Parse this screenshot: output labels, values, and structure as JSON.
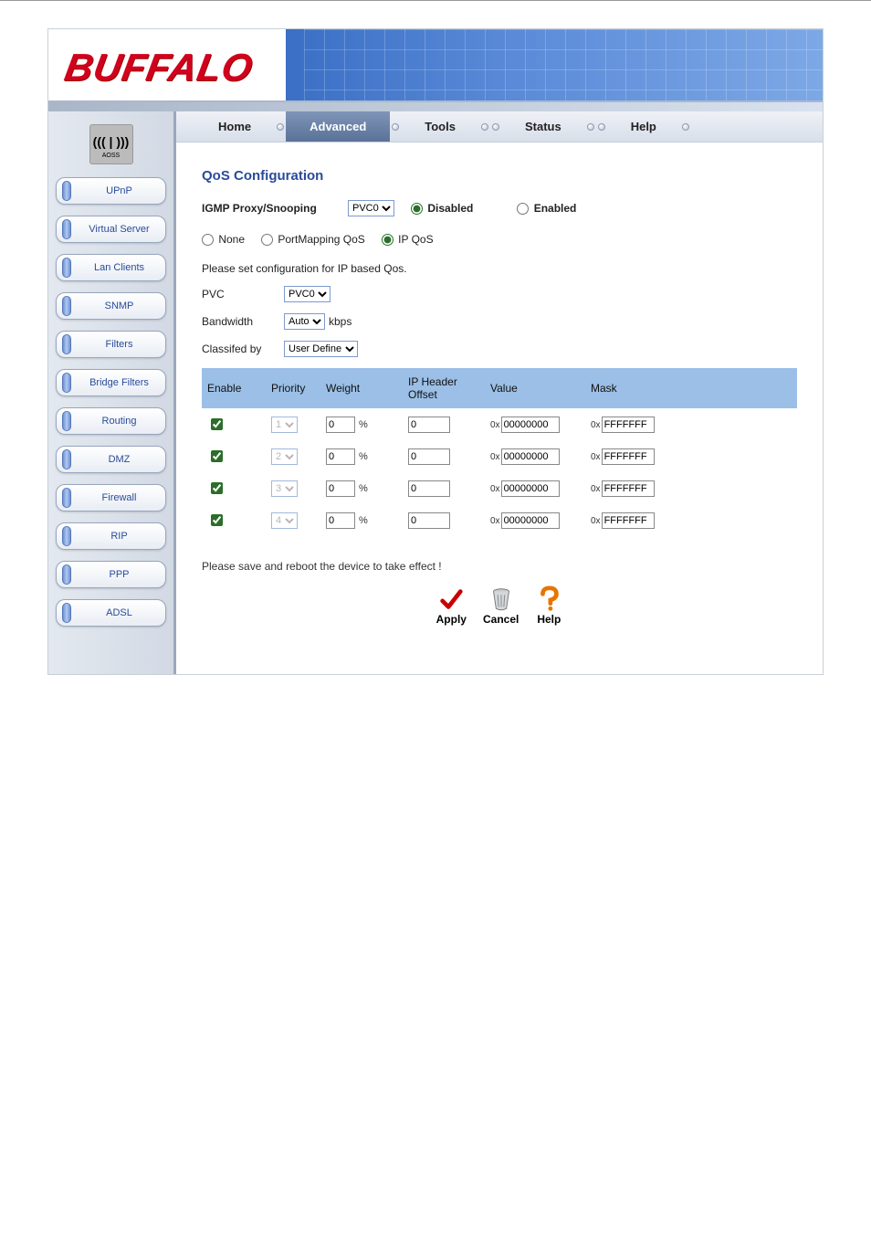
{
  "brand": "BUFFALO",
  "aoss_label": "AOSS",
  "topnav": {
    "items": [
      {
        "label": "Home"
      },
      {
        "label": "Advanced"
      },
      {
        "label": "Tools"
      },
      {
        "label": "Status"
      },
      {
        "label": "Help"
      }
    ],
    "active": 1
  },
  "sidebar": {
    "items": [
      {
        "label": "UPnP"
      },
      {
        "label": "Virtual Server"
      },
      {
        "label": "Lan Clients"
      },
      {
        "label": "SNMP"
      },
      {
        "label": "Filters"
      },
      {
        "label": "Bridge Filters"
      },
      {
        "label": "Routing"
      },
      {
        "label": "DMZ"
      },
      {
        "label": "Firewall"
      },
      {
        "label": "RIP"
      },
      {
        "label": "PPP"
      },
      {
        "label": "ADSL"
      }
    ]
  },
  "page_title": "QoS Configuration",
  "igmp": {
    "label": "IGMP Proxy/Snooping",
    "pvc_value": "PVC0",
    "disabled_label": "Disabled",
    "enabled_label": "Enabled",
    "state": "disabled"
  },
  "qos_mode": {
    "none_label": "None",
    "portmapping_label": "PortMapping QoS",
    "ipqos_label": "IP QoS",
    "selected": "ipqos"
  },
  "hint": "Please set configuration for IP based Qos.",
  "pvc": {
    "label": "PVC",
    "value": "PVC0"
  },
  "bandwidth": {
    "label": "Bandwidth",
    "value": "Auto",
    "unit": "kbps"
  },
  "classified": {
    "label": "Classifed by",
    "value": "User Define"
  },
  "table": {
    "headers": {
      "enable": "Enable",
      "priority": "Priority",
      "weight": "Weight",
      "offset": "IP Header Offset",
      "value": "Value",
      "mask": "Mask"
    },
    "hex_prefix": "0x",
    "pct": "%",
    "rows": [
      {
        "enable": true,
        "priority": "1",
        "weight": "0",
        "offset": "0",
        "value": "00000000",
        "mask": "FFFFFFF"
      },
      {
        "enable": true,
        "priority": "2",
        "weight": "0",
        "offset": "0",
        "value": "00000000",
        "mask": "FFFFFFF"
      },
      {
        "enable": true,
        "priority": "3",
        "weight": "0",
        "offset": "0",
        "value": "00000000",
        "mask": "FFFFFFF"
      },
      {
        "enable": true,
        "priority": "4",
        "weight": "0",
        "offset": "0",
        "value": "00000000",
        "mask": "FFFFFFF"
      }
    ]
  },
  "reboot_note": "Please save and reboot the device to take effect !",
  "actions": {
    "apply": "Apply",
    "cancel": "Cancel",
    "help": "Help"
  }
}
